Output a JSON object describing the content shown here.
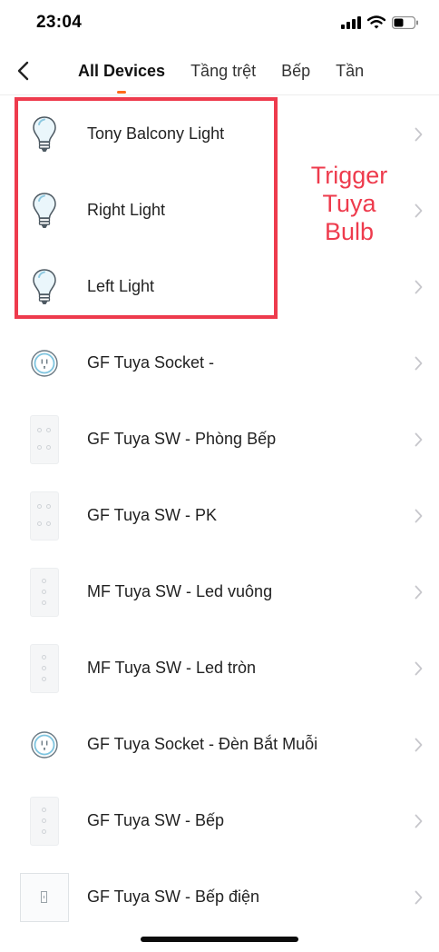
{
  "status_bar": {
    "time": "23:04"
  },
  "tabs": [
    {
      "label": "All Devices",
      "active": true
    },
    {
      "label": "Tầng trệt",
      "active": false
    },
    {
      "label": "Bếp",
      "active": false
    },
    {
      "label": "Tần",
      "active": false
    }
  ],
  "devices": [
    {
      "name": "Tony Balcony Light",
      "icon": "bulb-icon"
    },
    {
      "name": "Right Light",
      "icon": "bulb-icon"
    },
    {
      "name": "Left Light",
      "icon": "bulb-icon"
    },
    {
      "name": "GF Tuya Socket -",
      "icon": "socket-icon"
    },
    {
      "name": "GF Tuya SW - Phòng Bếp",
      "icon": "switch-4-icon"
    },
    {
      "name": "GF Tuya SW - PK",
      "icon": "switch-4-icon"
    },
    {
      "name": "MF Tuya SW - Led vuông",
      "icon": "switch-3-icon"
    },
    {
      "name": "MF Tuya SW - Led tròn",
      "icon": "switch-3-icon"
    },
    {
      "name": "GF Tuya Socket - Đèn Bắt Muỗi",
      "icon": "socket-icon"
    },
    {
      "name": "GF Tuya SW - Bếp",
      "icon": "switch-3-icon"
    },
    {
      "name": "GF Tuya SW - Bếp điện",
      "icon": "switch-1-icon"
    }
  ],
  "annotation": {
    "lines": [
      "Trigger",
      "Tuya",
      "Bulb"
    ]
  },
  "colors": {
    "accent": "#ff6a1a",
    "annotation": "#ee3b4d",
    "chevron": "#c7c7cc"
  }
}
